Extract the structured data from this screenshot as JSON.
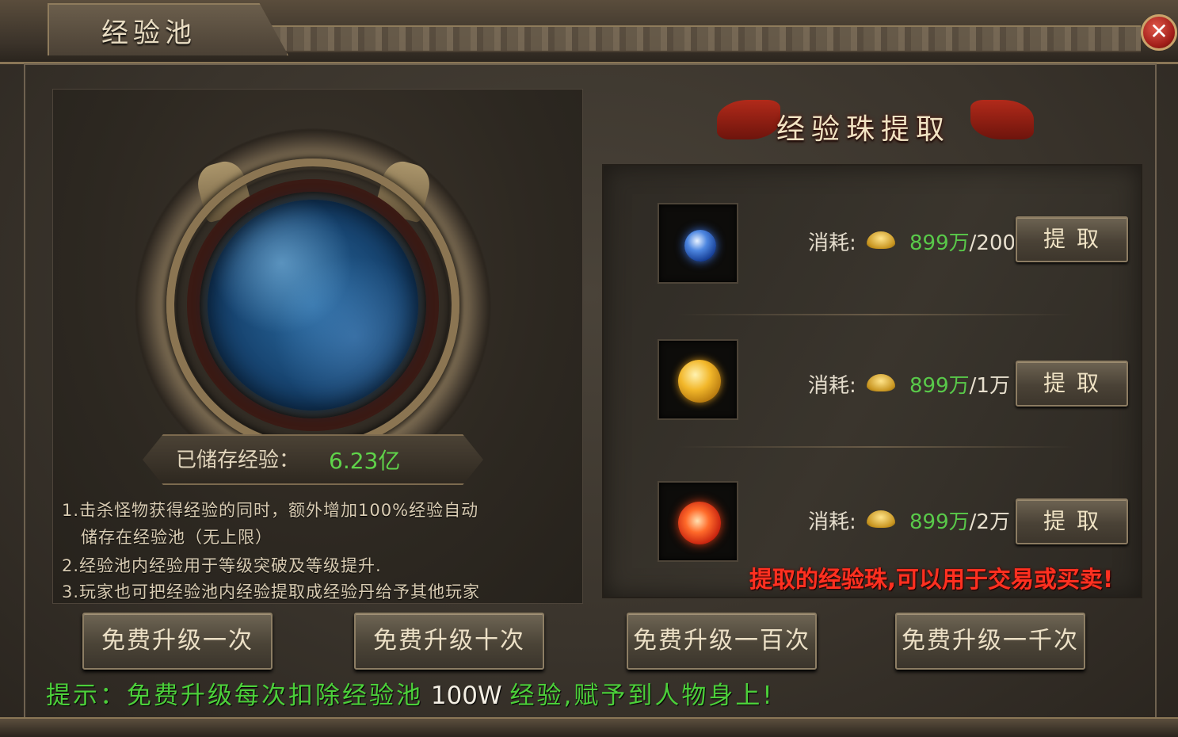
{
  "window": {
    "title": "经验池",
    "close_label": "✕"
  },
  "pool": {
    "stored_label": "已储存经验：",
    "stored_value": "6.23亿",
    "notes": [
      "1.击杀怪物获得经验的同时，额外增加100%经验自动",
      "储存在经验池（无上限）",
      "2.经验池内经验用于等级突破及等级提升.",
      "3.玩家也可把经验池内经验提取成经验丹给予其他玩家"
    ]
  },
  "extract": {
    "title": "经验珠提取",
    "items": [
      {
        "icon": "blue-exp-bead-icon",
        "cost_label": "消耗:",
        "cost_gold": "899万",
        "cost_exp": "/200",
        "button": "提取"
      },
      {
        "icon": "gold-exp-bead-icon",
        "cost_label": "消耗:",
        "cost_gold": "899万",
        "cost_exp": "/1万",
        "button": "提取"
      },
      {
        "icon": "red-exp-bead-icon",
        "cost_label": "消耗:",
        "cost_gold": "899万",
        "cost_exp": "/2万",
        "button": "提取"
      }
    ],
    "trade_note": "提取的经验珠,可以用于交易或买卖!"
  },
  "upgrade_buttons": [
    "免费升级一次",
    "免费升级十次",
    "免费升级一百次",
    "免费升级一千次"
  ],
  "tip": {
    "prefix": "提示：免费升级每次扣除经验池",
    "amount": "100W",
    "suffix": "经验,赋予到人物身上!"
  },
  "colors": {
    "accent_green": "#59c94a",
    "warning_red": "#ff3020",
    "panel_brown": "#3a342c",
    "gold_border": "#8b7552"
  }
}
